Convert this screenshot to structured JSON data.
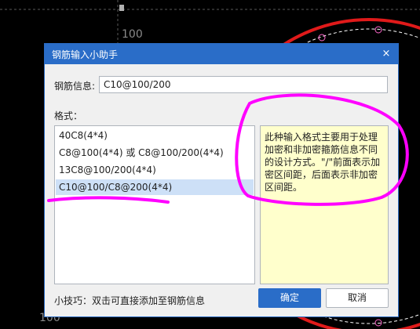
{
  "background": {
    "labels": [
      "100",
      "100"
    ]
  },
  "dialog": {
    "title": "钢筋输入小助手",
    "close_glyph": "×",
    "info_label": "钢筋信息:",
    "info_value": "C10@100/200",
    "format_label": "格式：",
    "formats": [
      "40C8(4*4)",
      "C8@100(4*4) 或 C8@100/200(4*4)",
      "13C8@100/200(4*4)",
      "C10@100/C8@200(4*4)"
    ],
    "selected_index": 3,
    "description": "此种输入格式主要用于处理加密和非加密箍筋信息不同的设计方式。\"/\"前面表示加密区间距，后面表示非加密区间距。",
    "tip": "小技巧：双击可直接添加至钢筋信息",
    "ok_label": "确定",
    "cancel_label": "取消"
  },
  "colors": {
    "accent": "#2a6dc8",
    "selection": "#cde0f7",
    "description_bg": "#ffffcc",
    "annotation": "#ff00ff",
    "cad_circle": "#e01a1a"
  }
}
